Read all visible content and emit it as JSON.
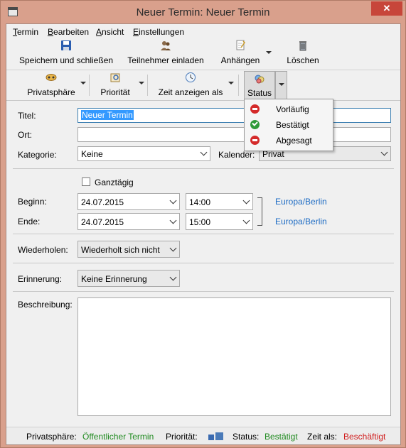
{
  "window": {
    "title": "Neuer Termin: Neuer Termin",
    "close_glyph": "✕"
  },
  "menu": {
    "items": [
      "Termin",
      "Bearbeiten",
      "Ansicht",
      "Einstellungen"
    ],
    "underline": [
      "T",
      "B",
      "A",
      "E"
    ]
  },
  "toolbar": {
    "save": "Speichern und schließen",
    "invite": "Teilnehmer einladen",
    "attach": "Anhängen",
    "delete": "Löschen"
  },
  "toolbar2": {
    "privacy": "Privatsphäre",
    "priority": "Priorität",
    "show_time_as": "Zeit anzeigen als",
    "status": "Status"
  },
  "form": {
    "title_label": "Titel:",
    "title_value": "Neuer Termin",
    "location_label": "Ort:",
    "location_value": "",
    "category_label": "Kategorie:",
    "category_value": "Keine",
    "calendar_label": "Kalender:",
    "calendar_value": "Privat",
    "allday_label": "Ganztägig",
    "allday_checked": false,
    "start_label": "Beginn:",
    "start_date": "24.07.2015",
    "start_time": "14:00",
    "start_tz": "Europa/Berlin",
    "end_label": "Ende:",
    "end_date": "24.07.2015",
    "end_time": "15:00",
    "end_tz": "Europa/Berlin",
    "repeat_label": "Wiederholen:",
    "repeat_value": "Wiederholt sich nicht",
    "reminder_label": "Erinnerung:",
    "reminder_value": "Keine Erinnerung",
    "description_label": "Beschreibung:",
    "description_value": ""
  },
  "status_popup": {
    "items": [
      {
        "label": "Vorläufig",
        "icon": "red-minus-icon"
      },
      {
        "label": "Bestätigt",
        "icon": "green-check-icon"
      },
      {
        "label": "Abgesagt",
        "icon": "red-minus-icon"
      }
    ]
  },
  "statusbar": {
    "privacy_label": "Privatsphäre:",
    "privacy_value": "Öffentlicher Termin",
    "priority_label": "Priorität:",
    "status_label": "Status:",
    "status_value": "Bestätigt",
    "time_as_label": "Zeit als:",
    "time_as_value": "Beschäftigt"
  },
  "colors": {
    "titlebar": "#d9a08c",
    "close": "#c7463a",
    "link_blue": "#1e6cc4",
    "green": "#1f8a1f",
    "red": "#d12020",
    "selection": "#3399ff"
  }
}
